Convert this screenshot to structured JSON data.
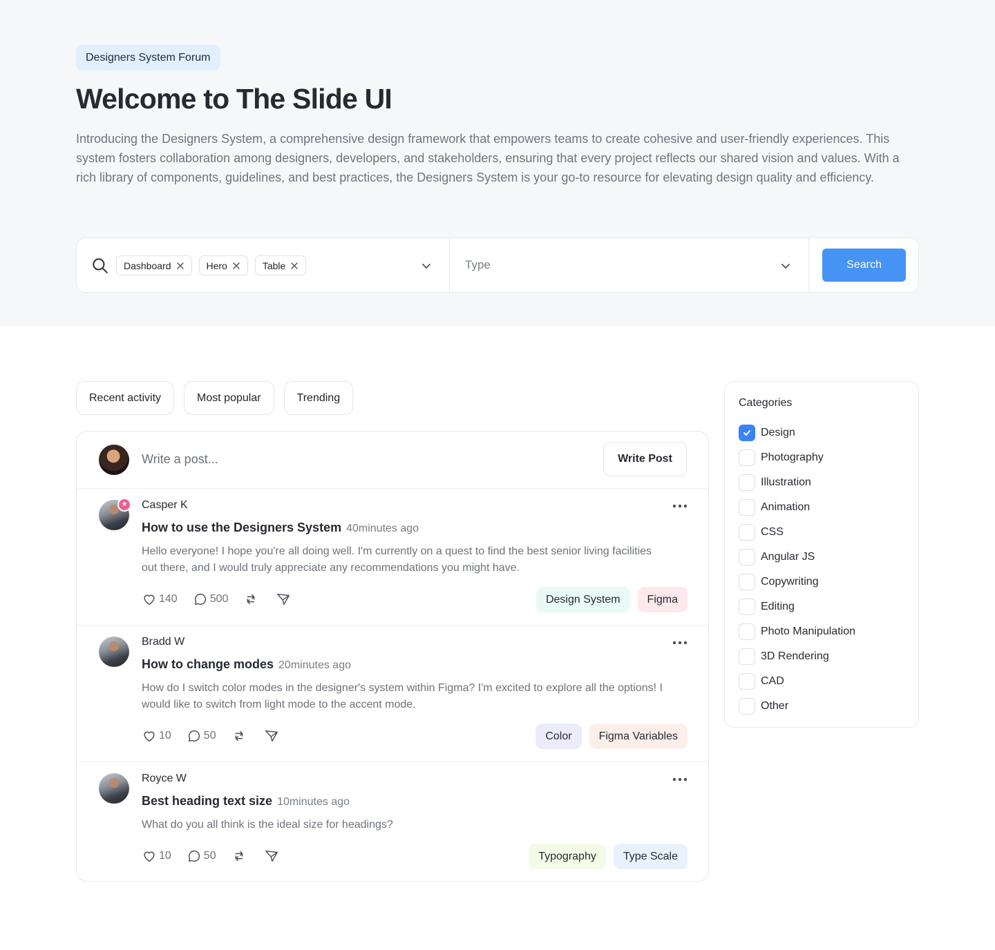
{
  "hero": {
    "badge": "Designers System Forum",
    "title": "Welcome to The Slide UI",
    "description": "Introducing the Designers System, a comprehensive design framework that empowers teams to create cohesive and user-friendly experiences. This system fosters collaboration among designers, developers, and stakeholders, ensuring that every project reflects our shared vision and values. With a rich library of components, guidelines, and best practices, the Designers System is your go-to resource for elevating design quality and efficiency."
  },
  "search": {
    "chips": [
      "Dashboard",
      "Hero",
      "Table"
    ],
    "type_placeholder": "Type",
    "button": "Search",
    "accent": "#4593f5"
  },
  "tabs": [
    "Recent activity",
    "Most popular",
    "Trending"
  ],
  "composer": {
    "placeholder": "Write a post...",
    "button": "Write Post"
  },
  "posts": [
    {
      "author": "Casper K",
      "title": "How to use the Designers System",
      "time": "40minutes ago",
      "body": "Hello everyone! I hope you're all doing well. I'm currently on a quest to find the best senior living facilities out there, and I would truly appreciate any recommendations you might have.",
      "likes": "140",
      "comments": "500",
      "tags": [
        {
          "label": "Design System",
          "bg": "#e9f9f6"
        },
        {
          "label": "Figma",
          "bg": "#fde8ec"
        }
      ]
    },
    {
      "author": "Bradd W",
      "title": "How to change modes",
      "time": "20minutes ago",
      "body": "How do I switch color modes in the designer's system within Figma? I'm excited to explore all the options! I would like to switch from light mode to the accent mode.",
      "likes": "10",
      "comments": "50",
      "tags": [
        {
          "label": "Color",
          "bg": "#ecebfb"
        },
        {
          "label": "Figma Variables",
          "bg": "#fdeee9"
        }
      ]
    },
    {
      "author": "Royce W",
      "title": "Best heading text size",
      "time": "10minutes ago",
      "body": "What do you all think is the ideal size for headings?",
      "likes": "10",
      "comments": "50",
      "tags": [
        {
          "label": "Typography",
          "bg": "#f4fbe6"
        },
        {
          "label": "Type Scale",
          "bg": "#e8f2fd"
        }
      ]
    }
  ],
  "categories": {
    "title": "Categories",
    "items": [
      {
        "label": "Design",
        "checked": true
      },
      {
        "label": "Photography",
        "checked": false
      },
      {
        "label": "Illustration",
        "checked": false
      },
      {
        "label": "Animation",
        "checked": false
      },
      {
        "label": "CSS",
        "checked": false
      },
      {
        "label": "Angular JS",
        "checked": false
      },
      {
        "label": "Copywriting",
        "checked": false
      },
      {
        "label": "Editing",
        "checked": false
      },
      {
        "label": "Photo Manipulation",
        "checked": false
      },
      {
        "label": "3D Rendering",
        "checked": false
      },
      {
        "label": "CAD",
        "checked": false
      },
      {
        "label": "Other",
        "checked": false
      }
    ]
  }
}
